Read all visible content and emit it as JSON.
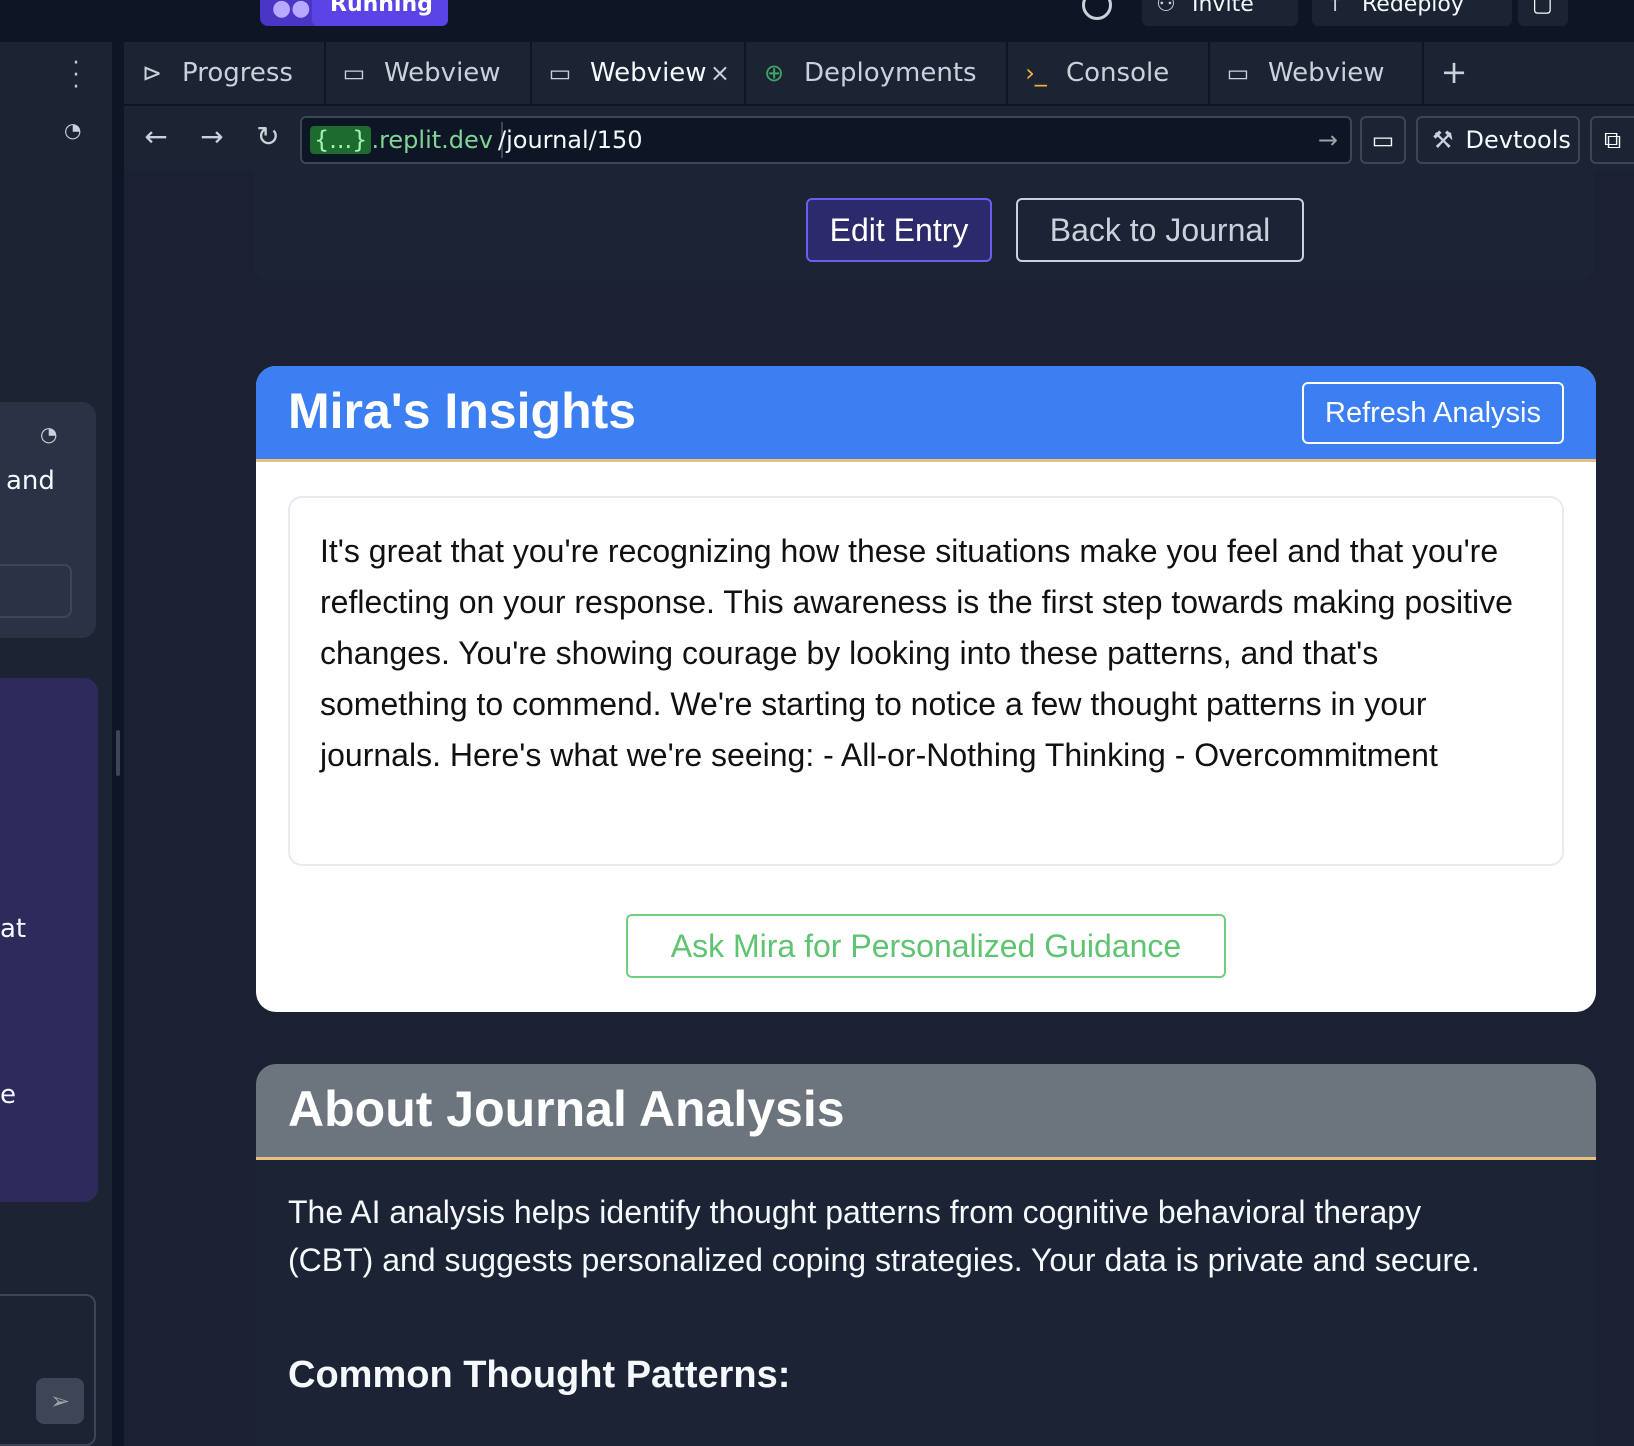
{
  "topbar": {
    "run_label": "Running",
    "invite_label": "Invite",
    "redeploy_label": "Redeploy"
  },
  "left_panel": {
    "card_text_1": "and",
    "card_text_2": "at",
    "card_text_3": "e"
  },
  "tabs": [
    {
      "label": "Progress",
      "icon": "progress-icon"
    },
    {
      "label": "Webview",
      "icon": "monitor-icon"
    },
    {
      "label": "Webview",
      "icon": "monitor-icon",
      "active": true
    },
    {
      "label": "Deployments",
      "icon": "deploy-icon"
    },
    {
      "label": "Console",
      "icon": "terminal-icon"
    },
    {
      "label": "Webview",
      "icon": "monitor-icon"
    }
  ],
  "address": {
    "host_brace": "{...}",
    "host": ".replit.dev",
    "path": "/journal/150",
    "devtools_label": "Devtools"
  },
  "entry_actions": {
    "edit_label": "Edit Entry",
    "back_label": "Back to Journal"
  },
  "insights": {
    "title": "Mira's Insights",
    "refresh_label": "Refresh Analysis",
    "body": "It's great that you're recognizing how these situations make you feel and that you're reflecting on your response. This awareness is the first step towards making positive changes. You're showing courage by looking into these patterns, and that's something to commend. We're starting to notice a few thought patterns in your journals. Here's what we're seeing: - All-or-Nothing Thinking - Overcommitment",
    "ask_label": "Ask Mira for Personalized Guidance"
  },
  "about": {
    "title": "About Journal Analysis",
    "body": "The AI analysis helps identify thought patterns from cognitive behavioral therapy (CBT) and suggests personalized coping strategies. Your data is private and secure.",
    "subtitle": "Common Thought Patterns:"
  },
  "colors": {
    "insights_header": "#3b7ff3",
    "about_header": "#6c757d",
    "accent_gold": "#e8c27c",
    "ask_green": "#5fc472",
    "edit_purple": "#6d5cf0"
  }
}
